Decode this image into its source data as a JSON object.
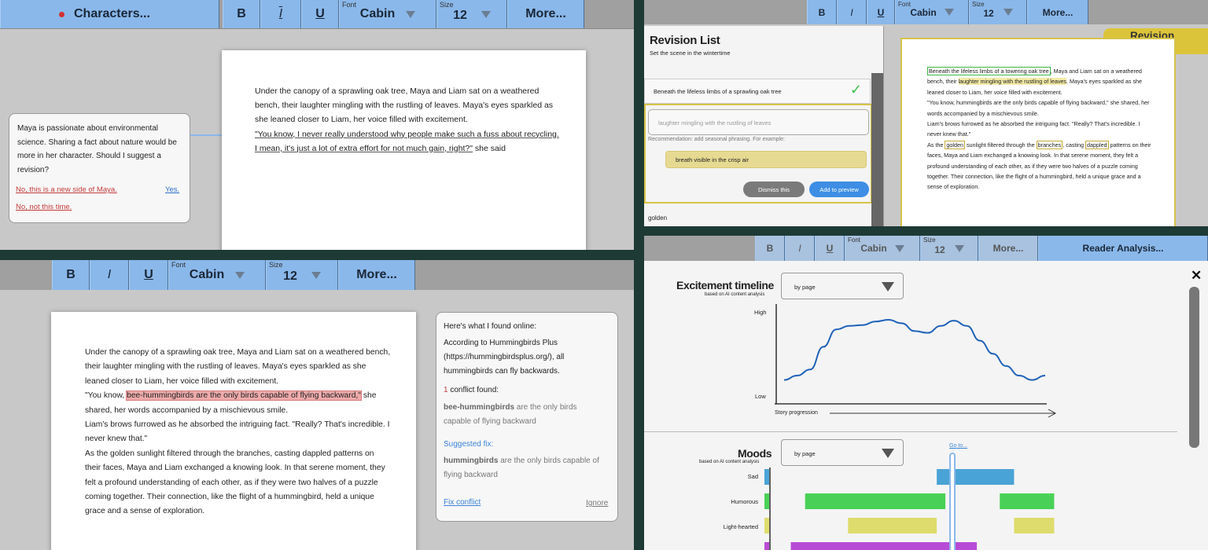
{
  "tl": {
    "characters": "Characters...",
    "bold": "B",
    "italic": "I",
    "underline": "U",
    "font_caption": "Font",
    "font": "Cabin",
    "size_caption": "Size",
    "size": "12",
    "more": "More...",
    "suggestion": {
      "text": "Maya is passionate about environmental science. Sharing a fact about nature would be more in her character. Should I suggest a revision?",
      "no_new": "No, this is a new side of Maya.",
      "yes": "Yes.",
      "no_not_now": "No, not this time."
    },
    "para1": "Under the canopy of a sprawling oak tree, Maya and Liam sat on a weathered bench, their laughter mingling with the rustling of leaves. Maya's eyes sparkled as she leaned closer to Liam, her voice filled with excitement.",
    "quote": "\"You know, I never really understood why people make such a fuss about recycling. I mean, it's just a lot of extra effort for not much gain, right?\"",
    "quote_tail": " she said"
  },
  "tr": {
    "bold": "B",
    "italic": "I",
    "underline": "U",
    "font_caption": "Font",
    "font": "Cabin",
    "size_caption": "Size",
    "size": "12",
    "more": "More...",
    "revision_title": "Revision List",
    "revision_sub": "Set the scene in the wintertime",
    "item1": "Beneath the lifeless limbs of a sprawling oak tree",
    "item2_input": "laughter mingling with the rustling of leaves",
    "recommendation": "Recommendation: add seasonal phrasing. For example:",
    "example": "breath visible in the crisp air",
    "dismiss": "Dismiss this",
    "add_preview": "Add to preview",
    "item3": "golden",
    "preview_tab": "Revision Preview",
    "preview": {
      "s1": "Beneath the lifeless limbs of a towering oak tree",
      "s2": ", Maya and Liam sat on a weathered bench, their ",
      "s3": "laughter mingling with the rustling of leaves",
      "s4": ". Maya's eyes sparkled as she leaned closer to Liam, her voice filled with excitement.",
      "s5": "\"You know, hummingbirds are the only birds capable of flying backward,\" she shared, her words accompanied by a mischievous smile.",
      "s6": "Liam's brows furrowed as he absorbed the intriguing fact. \"Really? That's incredible. I never knew that.\"",
      "s7": "As the ",
      "s8": "golden",
      "s9": " sunlight filtered through the ",
      "s10": "branches",
      "s11": ", casting ",
      "s12": "dappled",
      "s13": " patterns on their faces, Maya and Liam exchanged a knowing look. In that serene moment, they felt a profound understanding of each other, as if they were two halves of a puzzle coming together. Their connection, like the flight of a hummingbird, held a unique grace and a sense of exploration."
    }
  },
  "bl": {
    "bold": "B",
    "italic": "I",
    "underline": "U",
    "font_caption": "Font",
    "font": "Cabin",
    "size_caption": "Size",
    "size": "12",
    "more": "More...",
    "p1": "Under the canopy of a sprawling oak tree, Maya and Liam sat on a weathered bench, their laughter mingling with the rustling of leaves. Maya's eyes sparkled as she leaned closer to Liam, her voice filled with excitement.",
    "q_pre": "\"You know, ",
    "q_hl": "bee-hummingbirds are the only birds capable of flying backward,\"",
    "q_post": " she shared, her words accompanied by a mischievous smile.",
    "p3": "Liam's brows furrowed as he absorbed the intriguing fact. \"Really? That's incredible. I never knew that.\"",
    "p4": "As the golden sunlight filtered through the branches, casting dappled patterns on their faces, Maya and Liam exchanged a knowing look. In that serene moment, they felt a profound understanding of each other, as if they were two halves of a puzzle coming together. Their connection, like the flight of a hummingbird, held a unique grace and a sense of exploration.",
    "fact": {
      "found": "Here's what I found online:",
      "source": "According to Hummingbirds Plus (https://hummingbirdsplus.org/), all hummingbirds can fly backwards.",
      "count": "1",
      "conflict_label": " conflict found:",
      "c_bold": "bee-hummingbirds",
      "c_rest": " are the only birds capable of flying backward",
      "fix_label": "Suggested fix:",
      "f_bold": "hummingbirds",
      "f_rest": " are the only birds capable of flying backward",
      "fix": "Fix conflict",
      "ignore": "Ignore"
    }
  },
  "br": {
    "bold": "B",
    "italic": "I",
    "underline": "U",
    "font_caption": "Font",
    "font": "Cabin",
    "size_caption": "Size",
    "size": "12",
    "more": "More...",
    "reader": "Reader Analysis...",
    "close": "✕",
    "excitement_title": "Excitement timeline",
    "excitement_sub": "based on AI content analysis",
    "by_page": "by page",
    "high": "High",
    "low": "Low",
    "progression": "Story progression",
    "moods_title": "Moods",
    "moods_sub": "based on AI content analysis",
    "moods_by_page": "by page",
    "goto": "Go to...",
    "moods": [
      "Sad",
      "Humorous",
      "Light-hearted"
    ]
  },
  "chart_data": [
    {
      "type": "line",
      "title": "Excitement timeline",
      "xlabel": "Story progression",
      "ylabel": "",
      "y_ticks": [
        "Low",
        "High"
      ],
      "ylim": [
        0,
        1
      ],
      "x": [
        0,
        0.05,
        0.1,
        0.15,
        0.2,
        0.25,
        0.3,
        0.35,
        0.4,
        0.45,
        0.5,
        0.55,
        0.6,
        0.65,
        0.7,
        0.75,
        0.8,
        0.85,
        0.9,
        0.95,
        1.0
      ],
      "values": [
        0.22,
        0.27,
        0.34,
        0.6,
        0.8,
        0.84,
        0.85,
        0.89,
        0.91,
        0.87,
        0.78,
        0.76,
        0.84,
        0.9,
        0.84,
        0.67,
        0.52,
        0.38,
        0.27,
        0.22,
        0.27
      ],
      "color": "#1f62b8"
    },
    {
      "type": "bar",
      "title": "Moods",
      "categories": [
        "Sad",
        "Humorous",
        "Light-hearted",
        ""
      ],
      "segments": [
        {
          "mood": "Sad",
          "start": 0.58,
          "end": 0.85,
          "color": "#4aa3d6"
        },
        {
          "mood": "Humorous",
          "start": 0.12,
          "end": 0.61,
          "color": "#49d157"
        },
        {
          "mood": "Humorous",
          "start": 0.8,
          "end": 0.99,
          "color": "#49d157"
        },
        {
          "mood": "Light-hearted",
          "start": 0.27,
          "end": 0.58,
          "color": "#dedc6c"
        },
        {
          "mood": "Light-hearted",
          "start": 0.85,
          "end": 0.99,
          "color": "#dedc6c"
        },
        {
          "mood": "",
          "start": 0.07,
          "end": 0.72,
          "color": "#b84bd6"
        }
      ]
    }
  ]
}
